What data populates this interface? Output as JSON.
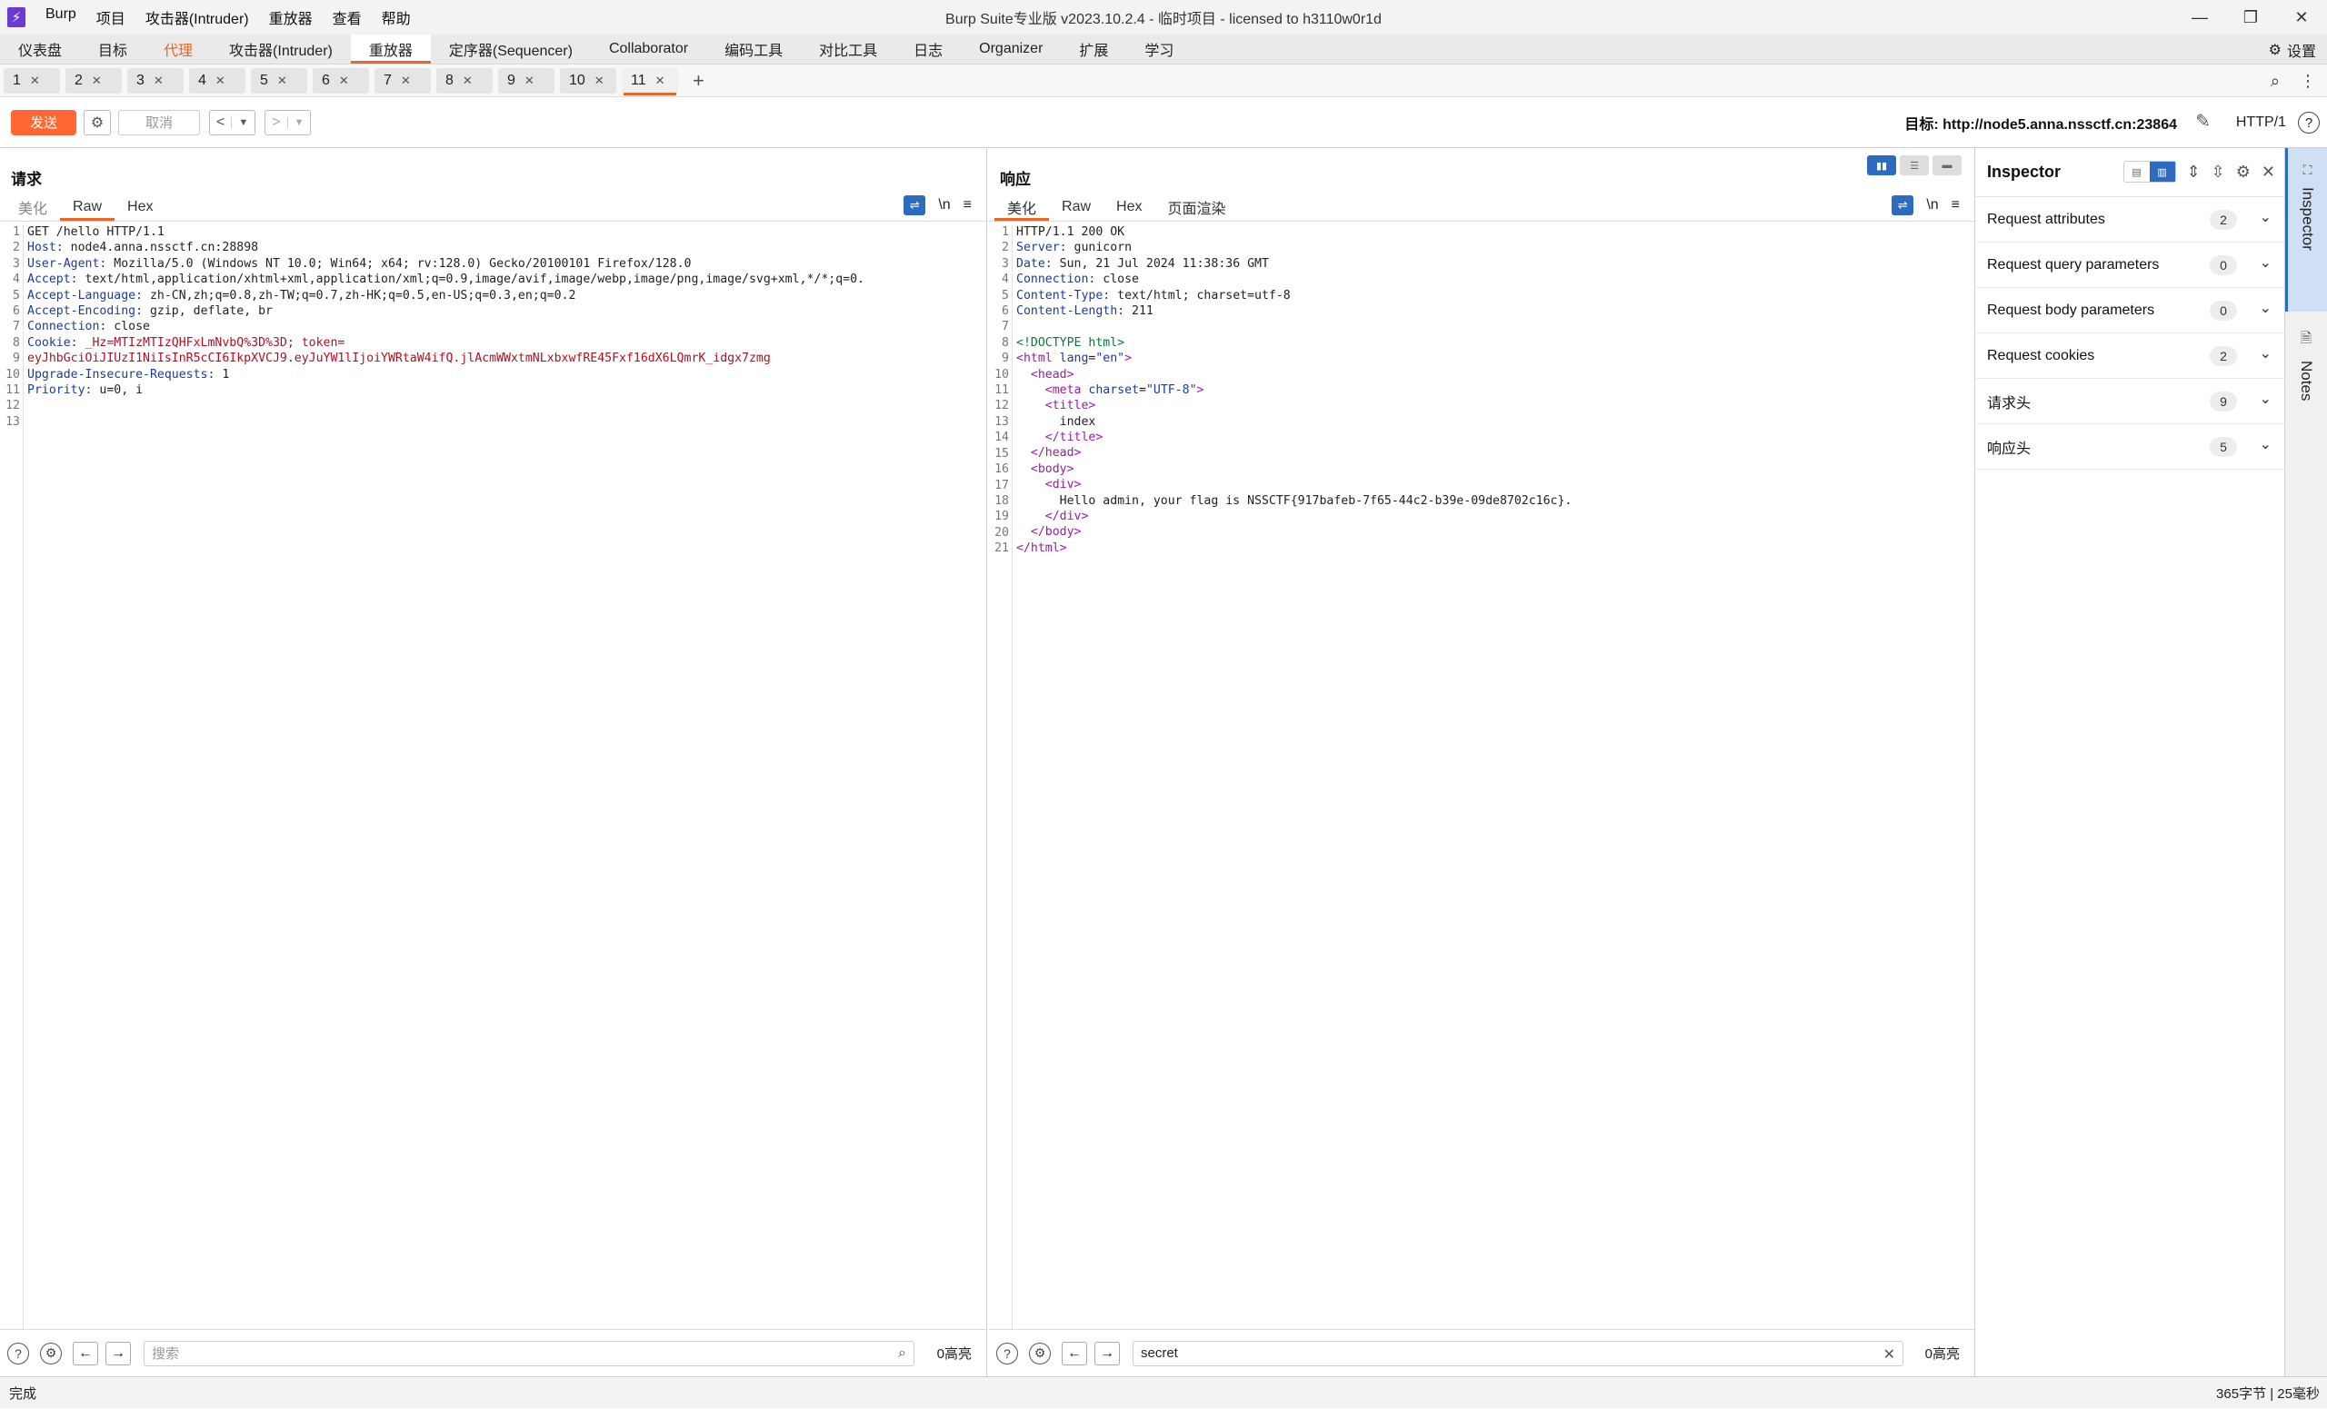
{
  "app": {
    "logo": "⚡",
    "window_title": "Burp Suite专业版  v2023.10.2.4 - 临时项目 - licensed to h3110w0r1d",
    "menu": [
      "Burp",
      "项目",
      "攻击器(Intruder)",
      "重放器",
      "查看",
      "帮助"
    ],
    "win_controls": [
      "—",
      "❐",
      "✕"
    ]
  },
  "tool_tabs": [
    {
      "label": "仪表盘"
    },
    {
      "label": "目标"
    },
    {
      "label": "代理"
    },
    {
      "label": "攻击器(Intruder)"
    },
    {
      "label": "重放器"
    },
    {
      "label": "定序器(Sequencer)"
    },
    {
      "label": "Collaborator"
    },
    {
      "label": "编码工具"
    },
    {
      "label": "对比工具"
    },
    {
      "label": "日志"
    },
    {
      "label": "Organizer"
    },
    {
      "label": "扩展"
    },
    {
      "label": "学习"
    }
  ],
  "settings_label": "设置",
  "repeater_tabs": [
    "1",
    "2",
    "3",
    "4",
    "5",
    "6",
    "7",
    "8",
    "9",
    "10",
    "11"
  ],
  "toolbar": {
    "send_label": "发送",
    "cancel_label": "取消",
    "target_label": "目标: http://node5.anna.nssctf.cn:23864",
    "http_version": "HTTP/1"
  },
  "request": {
    "title": "请求",
    "tabs": [
      "美化",
      "Raw",
      "Hex"
    ],
    "lines": [
      {
        "k": "",
        "v": "GET /hello HTTP/1.1"
      },
      {
        "k": "Host:",
        "v": " node4.anna.nssctf.cn:28898"
      },
      {
        "k": "User-Agent:",
        "v": " Mozilla/5.0 (Windows NT 10.0; Win64; x64; rv:128.0) Gecko/20100101 Firefox/128.0"
      },
      {
        "k": "Accept:",
        "v": " text/html,application/xhtml+xml,application/xml;q=0.9,image/avif,image/webp,image/png,image/svg+xml,*/*;q=0."
      },
      {
        "k": "Accept-Language:",
        "v": " zh-CN,zh;q=0.8,zh-TW;q=0.7,zh-HK;q=0.5,en-US;q=0.3,en;q=0.2"
      },
      {
        "k": "Accept-Encoding:",
        "v": " gzip, deflate, br"
      },
      {
        "k": "Connection:",
        "v": " close"
      },
      {
        "k": "Cookie:",
        "v": " _Hz=MTIzMTIzQHFxLmNvbQ%3D%3D; token="
      },
      {
        "k": "",
        "v": "eyJhbGciOiJIUzI1NiIsInR5cCI6IkpXVCJ9.eyJuYW1lIjoiYWRtaW4ifQ.jlAcmWWxtmNLxbxwfRE45Fxf16dX6LQmrK_idgx7zmg"
      },
      {
        "k": "Upgrade-Insecure-Requests:",
        "v": " 1"
      },
      {
        "k": "Priority:",
        "v": " u=0, i"
      },
      {
        "k": "",
        "v": ""
      },
      {
        "k": "",
        "v": ""
      }
    ],
    "search_placeholder": "搜索",
    "highlights": "0高亮"
  },
  "response": {
    "title": "响应",
    "tabs": [
      "美化",
      "Raw",
      "Hex",
      "页面渲染"
    ],
    "lines": [
      "HTTP/1.1 200 OK",
      "Server: gunicorn",
      "Date: Sun, 21 Jul 2024 11:38:36 GMT",
      "Connection: close",
      "Content-Type: text/html; charset=utf-8",
      "Content-Length: 211",
      "",
      "<!DOCTYPE html>",
      "<html lang=\"en\">",
      "  <head>",
      "    <meta charset=\"UTF-8\">",
      "    <title>",
      "      index",
      "    </title>",
      "  </head>",
      "  <body>",
      "    <div>",
      "      Hello admin, your flag is NSSCTF{917bafeb-7f65-44c2-b39e-09de8702c16c}.",
      "    </div>",
      "  </body>",
      "</html>"
    ],
    "search_value": "secret",
    "highlights": "0高亮"
  },
  "inspector": {
    "title": "Inspector",
    "sections": [
      {
        "label": "Request attributes",
        "count": "2"
      },
      {
        "label": "Request query parameters",
        "count": "0"
      },
      {
        "label": "Request body parameters",
        "count": "0"
      },
      {
        "label": "Request cookies",
        "count": "2"
      },
      {
        "label": "请求头",
        "count": "9"
      },
      {
        "label": "响应头",
        "count": "5"
      }
    ]
  },
  "side_tabs": [
    "Inspector",
    "Notes"
  ],
  "status": {
    "left": "完成",
    "right": "365字节 | 25毫秒"
  }
}
